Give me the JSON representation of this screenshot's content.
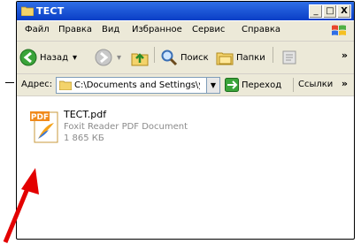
{
  "window": {
    "title": "ТЕСТ",
    "controls": {
      "minimize": "_",
      "maximize": "□",
      "close": "X"
    }
  },
  "menu": {
    "items": [
      "Файл",
      "Правка",
      "Вид",
      "Избранное",
      "Сервис",
      "Справка"
    ]
  },
  "toolbar": {
    "back_label": "Назад",
    "search_label": "Поиск",
    "folders_label": "Папки",
    "chevron": "»"
  },
  "address": {
    "label": "Адрес:",
    "value": "C:\\Documents and Settings\\y",
    "go_label": "Переход",
    "links_label": "Ссылки",
    "links_chevron": "»"
  },
  "files": [
    {
      "name": "TECT.pdf",
      "type": "Foxit Reader PDF Document",
      "size": "1 865 КБ",
      "icon": "pdf-file-icon",
      "icon_text": "PDF"
    }
  ],
  "annotation": {
    "arrow_color": "#ff0000"
  }
}
